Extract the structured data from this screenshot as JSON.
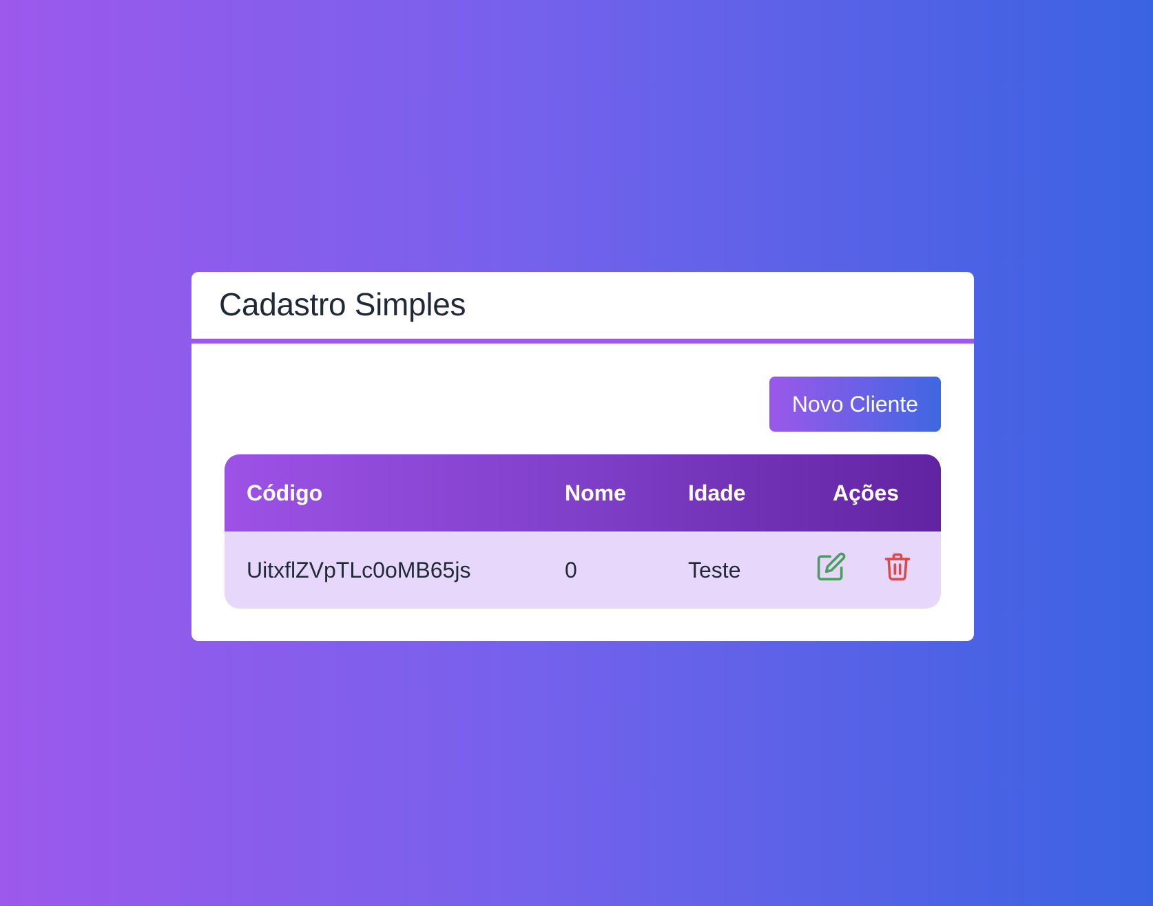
{
  "card": {
    "title": "Cadastro Simples",
    "new_button_label": "Novo Cliente"
  },
  "table": {
    "headers": {
      "codigo": "Código",
      "nome": "Nome",
      "idade": "Idade",
      "acoes": "Ações"
    },
    "rows": [
      {
        "codigo": "UitxflZVpTLc0oMB65js",
        "nome": "0",
        "idade": "Teste"
      }
    ],
    "icons": {
      "edit": "edit-icon",
      "delete": "trash-icon"
    }
  },
  "colors": {
    "edit": "#4a9e62",
    "delete": "#dc4b4b",
    "accent": "#9b5be8"
  }
}
